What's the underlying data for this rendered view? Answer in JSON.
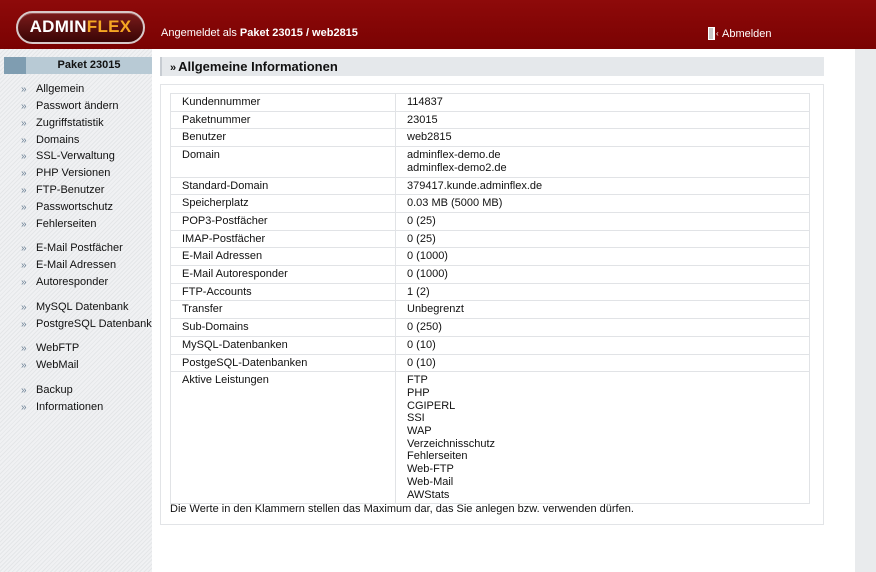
{
  "header": {
    "logo_part1": "ADMIN",
    "logo_part2": "FLEX",
    "login_prefix": "Angemeldet als",
    "login_value": "Paket 23015 / web2815",
    "logout_label": "Abmelden",
    "logout_icon": "door-exit-icon"
  },
  "sidebar": {
    "title": "Paket 23015",
    "bullet": "»",
    "items": [
      "Allgemein",
      "Passwort ändern",
      "Zugriffstatistik",
      "Domains",
      "SSL-Verwaltung",
      "PHP Versionen",
      "FTP-Benutzer",
      "Passwortschutz",
      "Fehlerseiten",
      "E-Mail Postfächer",
      "E-Mail Adressen",
      "Autoresponder",
      "MySQL Datenbank",
      "PostgreSQL Datenbank",
      "WebFTP",
      "WebMail",
      "Backup",
      "Informationen"
    ]
  },
  "main": {
    "title_marker": "»",
    "title": "Allgemeine Informationen",
    "rows": [
      {
        "label": "Kundennummer",
        "value": [
          "114837"
        ]
      },
      {
        "label": "Paketnummer",
        "value": [
          "23015"
        ]
      },
      {
        "label": "Benutzer",
        "value": [
          "web2815"
        ]
      },
      {
        "label": "Domain",
        "value": [
          "adminflex-demo.de",
          "adminflex-demo2.de"
        ]
      },
      {
        "label": "Standard-Domain",
        "value": [
          "379417.kunde.adminflex.de"
        ]
      },
      {
        "label": "Speicherplatz",
        "value": [
          "0.03 MB (5000 MB)"
        ]
      },
      {
        "label": "POP3-Postfächer",
        "value": [
          "0 (25)"
        ]
      },
      {
        "label": "IMAP-Postfächer",
        "value": [
          "0 (25)"
        ]
      },
      {
        "label": "E-Mail Adressen",
        "value": [
          "0 (1000)"
        ]
      },
      {
        "label": "E-Mail Autoresponder",
        "value": [
          "0 (1000)"
        ]
      },
      {
        "label": "FTP-Accounts",
        "value": [
          "1 (2)"
        ]
      },
      {
        "label": "Transfer",
        "value": [
          "Unbegrenzt"
        ]
      },
      {
        "label": "Sub-Domains",
        "value": [
          "0 (250)"
        ]
      },
      {
        "label": "MySQL-Datenbanken",
        "value": [
          "0 (10)"
        ]
      },
      {
        "label": "PostgeSQL-Datenbanken",
        "value": [
          "0 (10)"
        ]
      },
      {
        "label": "Aktive Leistungen",
        "value": [
          "FTP",
          "PHP",
          "CGIPERL",
          "SSI",
          "WAP",
          "Verzeichnisschutz",
          "Fehlerseiten",
          "Web-FTP",
          "Web-Mail",
          "AWStats"
        ]
      }
    ],
    "note": "Die Werte in den Klammern stellen das Maximum dar, das Sie anlegen bzw. verwenden dürfen."
  },
  "colors": {
    "header_red": "#7a0202",
    "logo_orange": "#f5a623",
    "sidebar_head": "#b8cad5",
    "sidebar_head_block": "#7f9db1"
  }
}
